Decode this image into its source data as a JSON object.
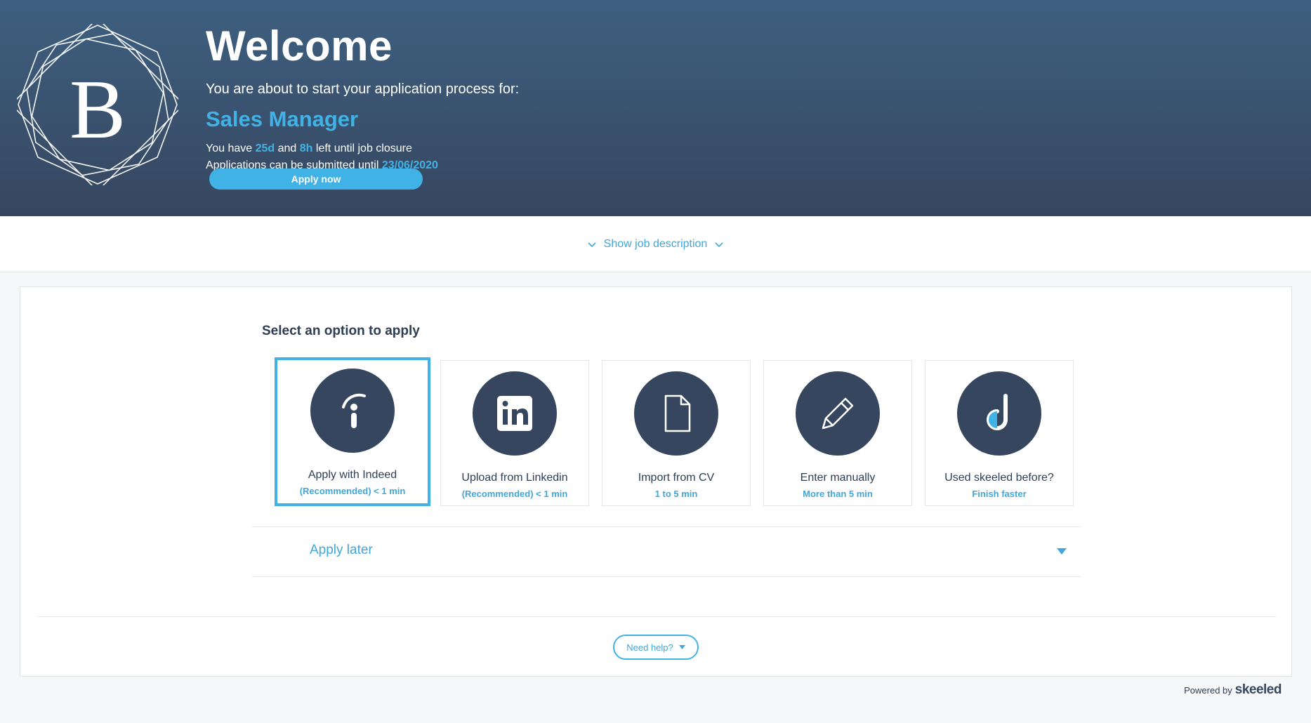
{
  "colors": {
    "accent": "#41b2e6",
    "header_dark": "#36465f",
    "header_light": "#3e6080",
    "text_dark": "#2f3e55"
  },
  "header": {
    "logo_letter": "B",
    "welcome": "Welcome",
    "intro": "You are about to start your application process for:",
    "job_title": "Sales Manager",
    "time_prefix": "You have",
    "days": "25d",
    "and": "and",
    "hours": "8h",
    "time_suffix": "left until job closure",
    "deadline_prefix": "Applications can be submitted until",
    "deadline_date": "23/06/2020",
    "apply_now": "Apply now"
  },
  "job_description": {
    "toggle_label": "Show job description",
    "icon": "chevron-down-icon"
  },
  "apply": {
    "title": "Select an option to apply",
    "options": [
      {
        "label": "Apply with Indeed",
        "sub": "(Recommended) < 1 min",
        "icon": "indeed-icon",
        "selected": true
      },
      {
        "label": "Upload from Linkedin",
        "sub": "(Recommended) < 1 min",
        "icon": "linkedin-icon",
        "selected": false
      },
      {
        "label": "Import from CV",
        "sub": "1 to 5 min",
        "icon": "document-icon",
        "selected": false
      },
      {
        "label": "Enter manually",
        "sub": "More than 5 min",
        "icon": "pencil-icon",
        "selected": false
      },
      {
        "label": "Used skeeled before?",
        "sub": "Finish faster",
        "icon": "skeeled-icon",
        "selected": false
      }
    ],
    "later_label": "Apply later"
  },
  "help": {
    "label": "Need help?"
  },
  "footer": {
    "powered_by": "Powered by",
    "brand": "skeeled"
  }
}
